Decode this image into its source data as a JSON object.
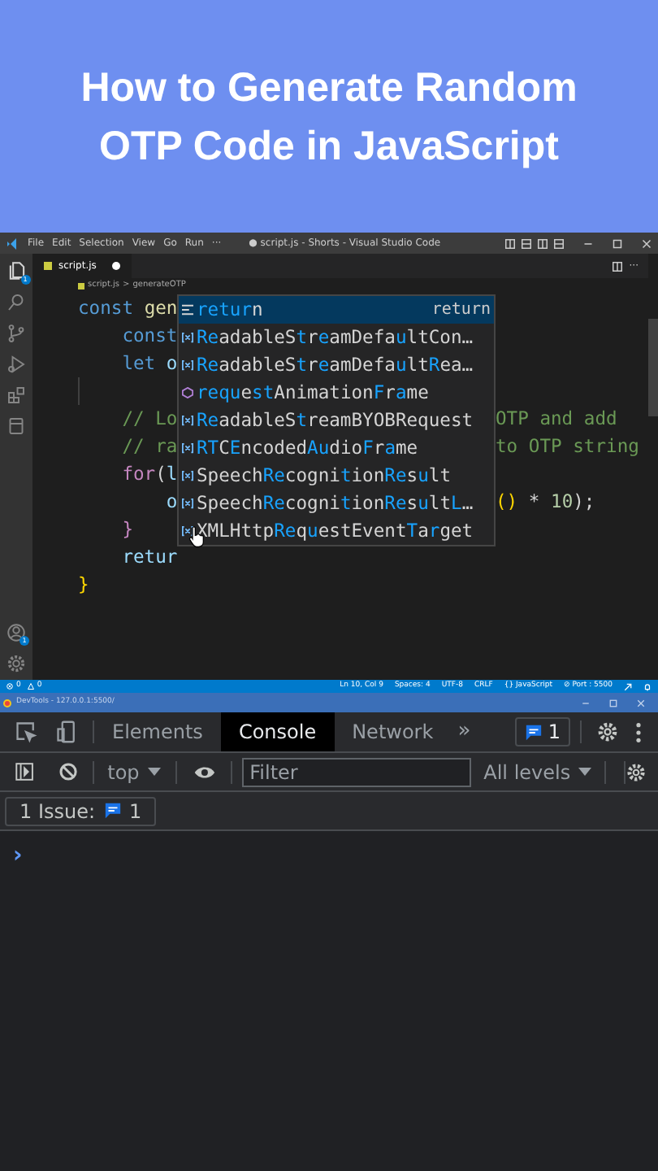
{
  "banner": {
    "title": "How to Generate Random OTP Code in JavaScript"
  },
  "titlebar": {
    "menu": [
      "File",
      "Edit",
      "Selection",
      "View",
      "Go",
      "Run",
      "···"
    ],
    "title": "● script.js - Shorts - Visual Studio Code"
  },
  "activity_bar": {
    "explorer_badge": "1",
    "accounts_badge": "1"
  },
  "editor_tab": {
    "label": "script.js",
    "modified": true,
    "more_actions": "···"
  },
  "breadcrumb": [
    "script.js",
    ">",
    "generateOTP"
  ],
  "code_lines": [
    {
      "tokens": [
        {
          "text": "const ",
          "kind": "keyword"
        },
        {
          "text": "gen",
          "kind": "function"
        }
      ]
    },
    {
      "tokens": [
        {
          "text": "    const",
          "kind": "keyword"
        }
      ]
    },
    {
      "tokens": [
        {
          "text": "    let ",
          "kind": "keyword"
        },
        {
          "text": "o",
          "kind": "variable"
        }
      ]
    },
    {
      "kind": "blank"
    },
    {
      "tokens": [
        {
          "text": "    // Lo",
          "kind": "comment"
        }
      ],
      "tail": [
        {
          "text": "OTP and add",
          "kind": "comment"
        }
      ]
    },
    {
      "tokens": [
        {
          "text": "    // ra",
          "kind": "comment"
        }
      ],
      "tail": [
        {
          "text": "to OTP string",
          "kind": "comment"
        }
      ]
    },
    {
      "tokens": [
        {
          "text": "    for",
          "kind": "control"
        },
        {
          "text": "(",
          "kind": "plain"
        },
        {
          "text": "l",
          "kind": "variable"
        }
      ]
    },
    {
      "tokens": [
        {
          "text": "        o",
          "kind": "variable"
        }
      ],
      "tail": [
        {
          "text": "() ",
          "kind": "bracket"
        },
        {
          "text": "* ",
          "kind": "plain"
        },
        {
          "text": "10",
          "kind": "number"
        },
        {
          "text": ");",
          "kind": "plain"
        }
      ]
    },
    {
      "tokens": [
        {
          "text": "    }",
          "kind": "control"
        }
      ]
    },
    {
      "tokens": [
        {
          "text": "    retur",
          "kind": "variable"
        }
      ]
    },
    {
      "tokens": [
        {
          "text": "}",
          "kind": "bracket"
        }
      ]
    }
  ],
  "suggestions": [
    {
      "label": "**retur**n",
      "detail": "return",
      "kind": "keyword",
      "selected": true
    },
    {
      "label": "**Re**adableS**t**r**e**amDefa**u**ltCon…",
      "kind": "variable",
      "selected": false
    },
    {
      "label": "**Re**adableS**t**r**e**amDefa**u**lt**R**ea…",
      "kind": "variable",
      "selected": false
    },
    {
      "label": "**requ**e**st**Animation**F**r**a**me",
      "kind": "method",
      "selected": false
    },
    {
      "label": "**Re**adableS**t**reamBYOBRequest",
      "kind": "variable",
      "selected": false
    },
    {
      "label": "**RT**C**E**ncoded**Au**dio**F**r**a**me",
      "kind": "variable",
      "selected": false
    },
    {
      "label": "Speech**Re**cogni**t**ion**Re**s**u**lt",
      "kind": "variable",
      "selected": false
    },
    {
      "label": "Speech**Re**cogni**t**ion**Re**s**u**lt**L**…",
      "kind": "variable",
      "selected": false
    },
    {
      "label": "XMLHttp**Re**q**u**estEvent**T**a**r**get",
      "kind": "variable",
      "selected": false
    }
  ],
  "status_bar": {
    "errors": "0",
    "warnings": "0",
    "items": [
      "Ln 10, Col 9",
      "Spaces: 4",
      "UTF-8",
      "CRLF",
      "{} JavaScript",
      "⊘ Port : 5500"
    ]
  },
  "devtools": {
    "window_title": "DevTools - 127.0.0.1:5500/",
    "tabs": [
      {
        "label": "Elements",
        "selected": false
      },
      {
        "label": "Console",
        "selected": true
      },
      {
        "label": "Network",
        "selected": false
      }
    ],
    "more": "»",
    "issues_count": "1",
    "context": "top",
    "filter_placeholder": "Filter",
    "levels": "All levels",
    "issues_label": "1 Issue:",
    "issues_bar_count": "1",
    "prompt": "›"
  }
}
